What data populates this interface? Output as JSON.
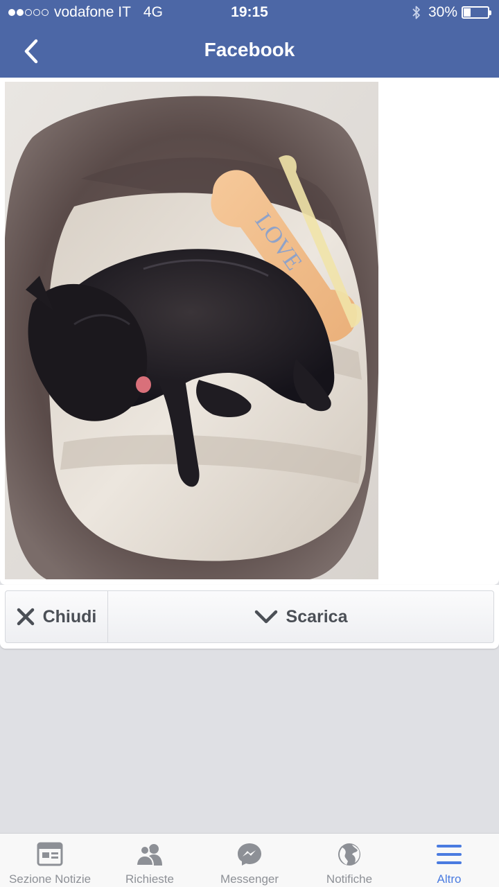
{
  "status_bar": {
    "carrier": "vodafone IT",
    "network": "4G",
    "time": "19:15",
    "battery_percent": "30%",
    "battery_level": 0.3,
    "signal_bars": 2,
    "signal_total": 5
  },
  "nav": {
    "title": "Facebook",
    "back_icon": "chevron-left-icon"
  },
  "photo": {
    "description_icon": "photo"
  },
  "actions": {
    "close_label": "Chiudi",
    "close_icon": "close-icon",
    "download_label": "Scarica",
    "download_icon": "chevron-down-icon"
  },
  "tabs": [
    {
      "label": "Sezione Notizie",
      "icon": "news-feed-icon",
      "active": false
    },
    {
      "label": "Richieste",
      "icon": "friend-requests-icon",
      "active": false
    },
    {
      "label": "Messenger",
      "icon": "messenger-icon",
      "active": false
    },
    {
      "label": "Notifiche",
      "icon": "globe-icon",
      "active": false
    },
    {
      "label": "Altro",
      "icon": "menu-icon",
      "active": true
    }
  ],
  "colors": {
    "brand_blue": "#4c67a6",
    "active_tab": "#4a7be0",
    "inactive_tab": "#8d9096",
    "background": "#dfe0e4"
  }
}
